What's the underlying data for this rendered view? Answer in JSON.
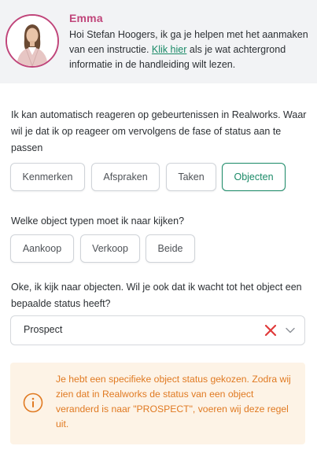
{
  "assistant": {
    "name": "Emma",
    "message_pre": "Hoi Stefan Hoogers, ik ga je helpen met het aanmaken van een instructie. ",
    "link_text": "Klik hier",
    "message_post": " als je wat achtergrond informatie in de handleiding wilt lezen."
  },
  "question1": {
    "text": "Ik kan automatisch reageren op gebeurtenissen in Realworks. Waar wil je dat ik op reageer om vervolgens de fase of status aan te passen",
    "options": [
      "Kenmerken",
      "Afspraken",
      "Taken",
      "Objecten"
    ],
    "selected": "Objecten"
  },
  "question2": {
    "text": "Welke object typen moet ik naar kijken?",
    "options": [
      "Aankoop",
      "Verkoop",
      "Beide"
    ]
  },
  "question3": {
    "text": "Oke, ik kijk naar objecten. Wil je ook dat ik wacht tot het object een bepaalde status heeft?",
    "select_value": "Prospect"
  },
  "notice": {
    "text": "Je hebt een specifieke object status gekozen. Zodra wij zien dat in Realworks de status van een object veranderd is naar \"PROSPECT\", voeren wij deze regel uit."
  },
  "colors": {
    "accent_green": "#1a8a67",
    "name_pink": "#c0457a",
    "warning_orange": "#e07a22",
    "clear_red": "#e03a3a"
  },
  "icons": {
    "avatar": "user-photo",
    "clear": "close-x-icon",
    "dropdown": "chevron-down-icon",
    "info": "info-circle-icon"
  }
}
